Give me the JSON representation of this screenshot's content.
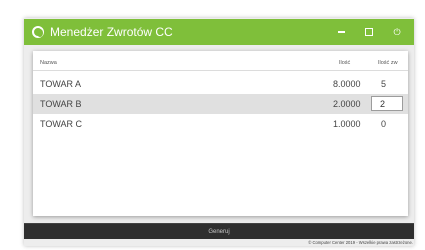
{
  "window": {
    "title": "Menedżer Zwrotów CC",
    "icons": {
      "app": "cc-logo-icon",
      "minimize": "minimize-icon",
      "maximize": "maximize-icon",
      "power": "power-icon"
    },
    "colors": {
      "titlebar": "#7fbf3a",
      "bottom_bar": "#2f2f2f",
      "selected_row": "#e0e0e0"
    }
  },
  "table": {
    "headers": {
      "name": "Nazwa",
      "quantity": "Ilość",
      "returned": "Ilość zw"
    },
    "rows": [
      {
        "name": "TOWAR A",
        "quantity": "8.0000",
        "returned": "5"
      },
      {
        "name": "TOWAR B",
        "quantity": "2.0000",
        "returned": "2",
        "selected": true
      },
      {
        "name": "TOWAR C",
        "quantity": "1.0000",
        "returned": "0"
      }
    ]
  },
  "actions": {
    "generate_label": "Generuj"
  },
  "footer": {
    "copyright": "© Computer Center 2019 - Wszelkie prawa zastrzeżone."
  }
}
